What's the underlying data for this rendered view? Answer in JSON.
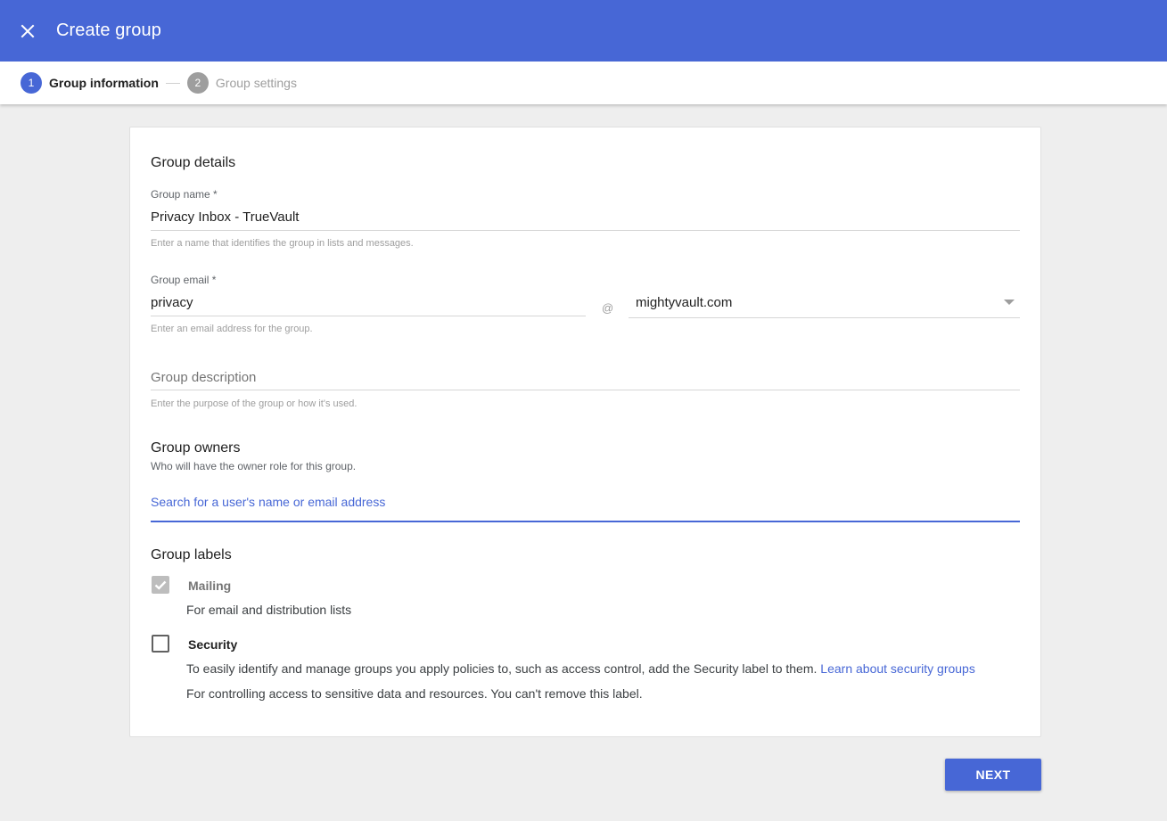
{
  "header": {
    "title": "Create group",
    "close_icon": "close-icon",
    "background_color": "#4767d6"
  },
  "stepper": {
    "steps": [
      {
        "number": "1",
        "label": "Group information",
        "state": "active"
      },
      {
        "number": "2",
        "label": "Group settings",
        "state": "inactive"
      }
    ]
  },
  "form": {
    "section_title": "Group details",
    "group_name": {
      "label": "Group name *",
      "value": "Privacy Inbox - TrueVault",
      "hint": "Enter a name that identifies the group in lists and messages."
    },
    "group_email": {
      "label": "Group email *",
      "value": "privacy",
      "at": "@",
      "domain": "mightyvault.com",
      "hint": "Enter an email address for the group."
    },
    "group_description": {
      "placeholder": "Group description",
      "hint": "Enter the purpose of the group or how it's used."
    },
    "group_owners": {
      "title": "Group owners",
      "subtitle": "Who will have the owner role for this group.",
      "search_placeholder": "Search for a user's name or email address"
    },
    "group_labels": {
      "title": "Group labels",
      "mailing": {
        "label": "Mailing",
        "checked": true,
        "disabled": true,
        "description": "For email and distribution lists"
      },
      "security": {
        "label": "Security",
        "checked": false,
        "description": "To easily identify and manage groups you apply policies to, such as access control, add the Security label to them.",
        "link": "Learn about security groups",
        "description2": "For controlling access to sensitive data and resources. You can't remove this label."
      }
    }
  },
  "footer": {
    "next_label": "NEXT"
  }
}
